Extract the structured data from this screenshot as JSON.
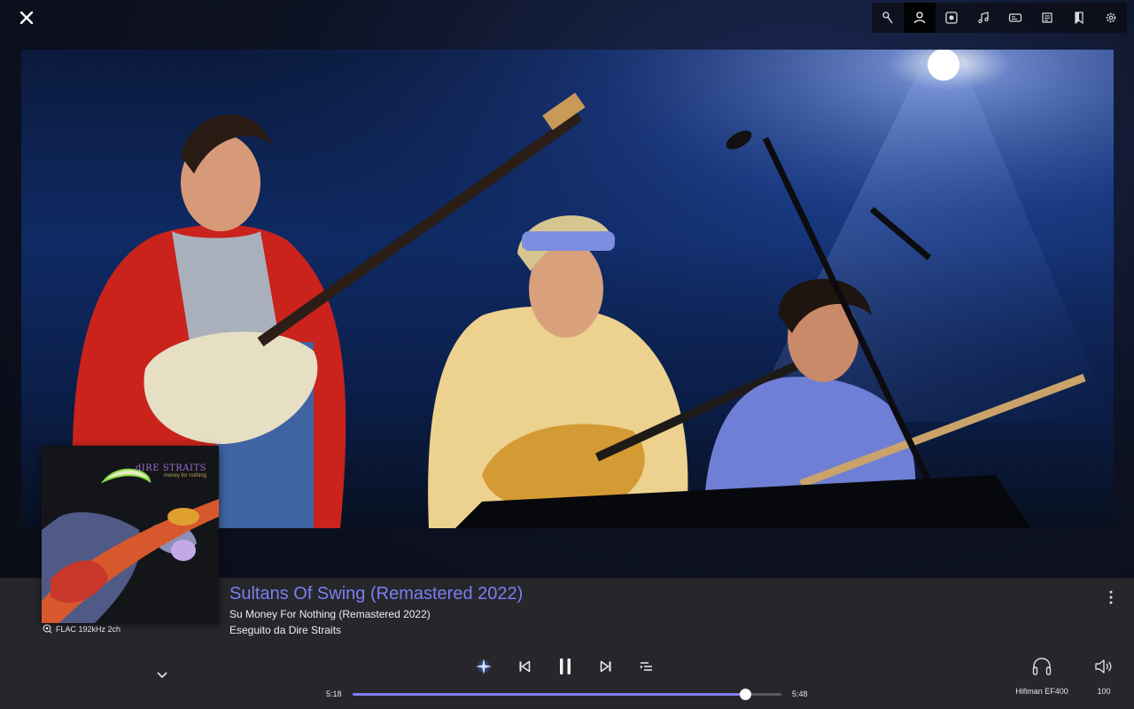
{
  "colors": {
    "accent": "#7b7ff0",
    "panel_bg": "#26262b",
    "text": "#f0f0f0"
  },
  "topbar": {
    "close_icon": "close-icon",
    "toolbar_icons": [
      "microphone-icon",
      "person-icon",
      "disc-icon",
      "music-note-icon",
      "credits-icon",
      "lyrics-icon",
      "book-icon",
      "gear-icon"
    ],
    "active_index": 1
  },
  "cover": {
    "brand": "dIRE STRAITS",
    "subtitle": "money for nothing"
  },
  "track": {
    "title": "Sultans Of Swing (Remastered 2022)",
    "album_line": "Su Money For Nothing (Remastered 2022)",
    "artist_line": "Eseguito da Dire Straits",
    "format": "FLAC 192kHz 2ch"
  },
  "playback": {
    "elapsed": "5:18",
    "total": "5:48",
    "progress": 0.915,
    "state": "playing"
  },
  "output": {
    "device_name": "Hifiman EF400",
    "volume": "100"
  }
}
